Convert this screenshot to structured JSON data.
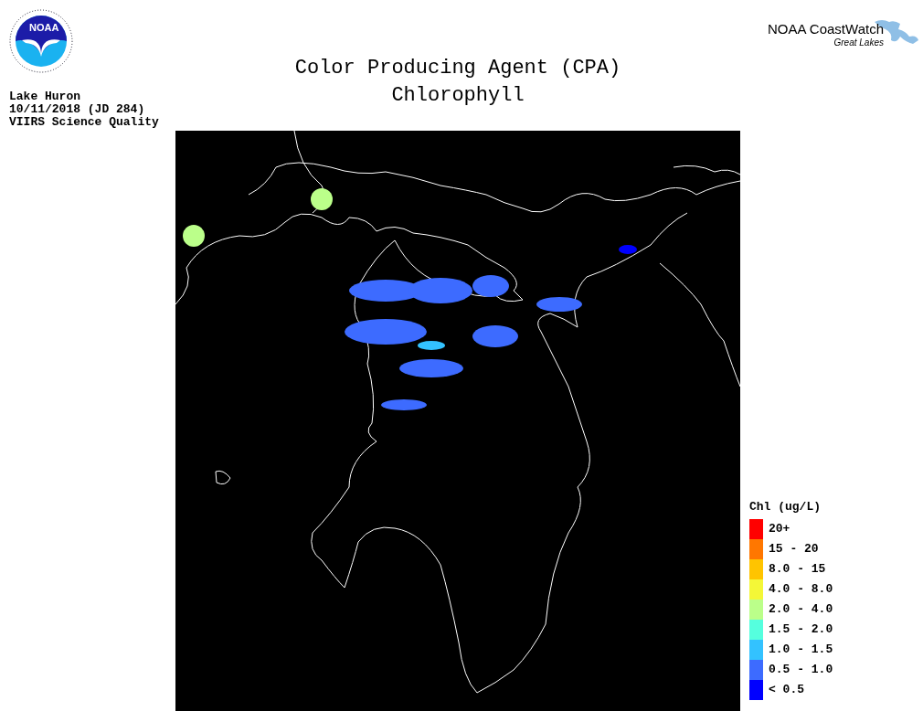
{
  "noaa_logo": {
    "text": "NOAA"
  },
  "title_lines": [
    "Color Producing Agent (CPA)",
    "Chlorophyll"
  ],
  "info_lines": [
    "Lake Huron",
    "10/11/2018 (JD 284)",
    "VIIRS Science Quality"
  ],
  "coastwatch_logo": {
    "name": "NOAA CoastWatch",
    "subtitle": "Great Lakes"
  },
  "legend": {
    "title": "Chl (ug/L)",
    "items": [
      {
        "label": "20+",
        "color": "#ff0000"
      },
      {
        "label": "15 - 20",
        "color": "#ff7700"
      },
      {
        "label": "8.0 - 15",
        "color": "#ffc400"
      },
      {
        "label": "4.0 - 8.0",
        "color": "#f4f737"
      },
      {
        "label": "2.0 - 4.0",
        "color": "#bbff8a"
      },
      {
        "label": "1.5 - 2.0",
        "color": "#55ffde"
      },
      {
        "label": "1.0 - 1.5",
        "color": "#33c2ff"
      },
      {
        "label": "0.5 - 1.0",
        "color": "#3d6bff"
      },
      {
        "label": "< 0.5",
        "color": "#0000ff"
      }
    ]
  }
}
